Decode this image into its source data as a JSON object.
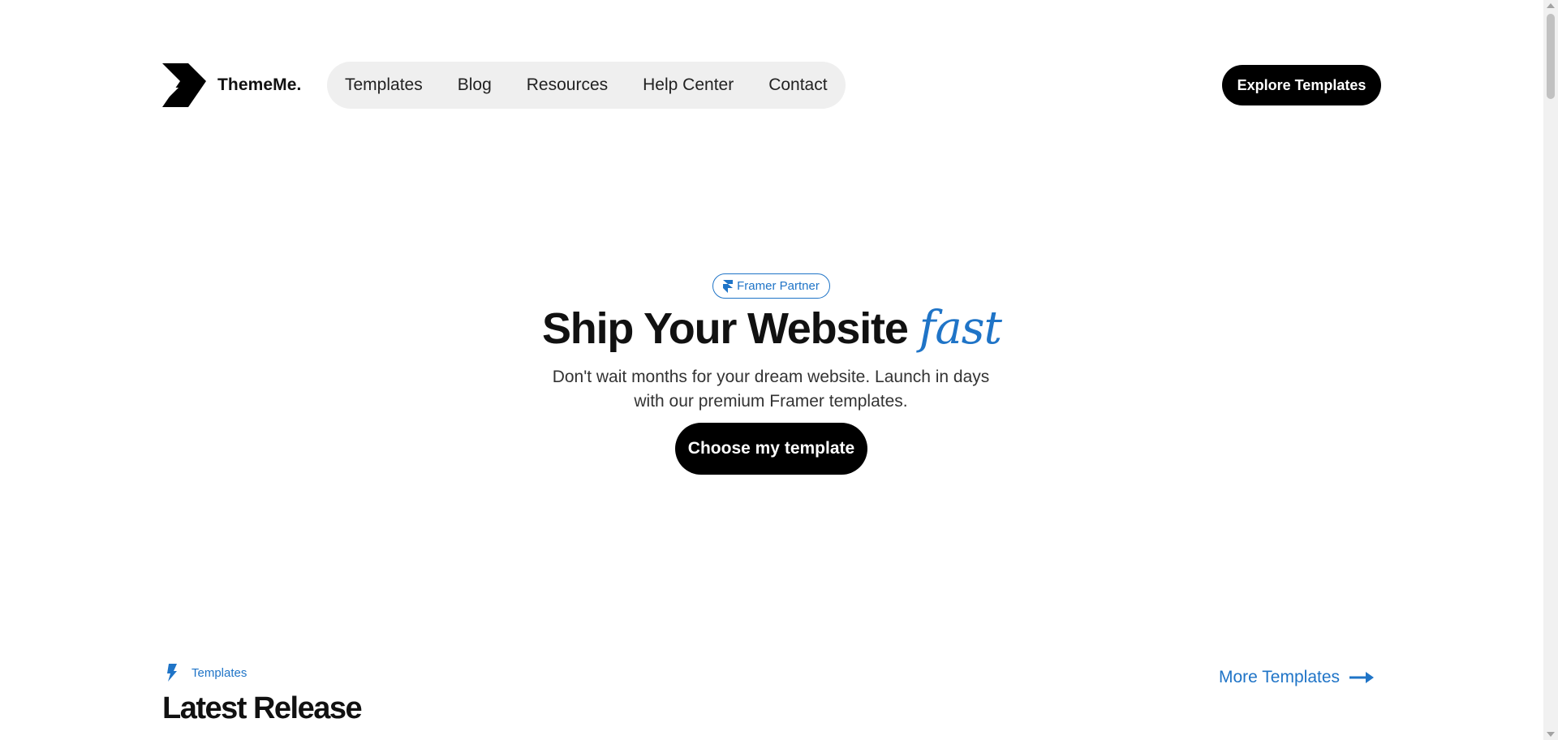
{
  "header": {
    "brand": "ThemeMe.",
    "logo_icon": "thememe-logo-icon",
    "nav": [
      {
        "label": "Templates"
      },
      {
        "label": "Blog"
      },
      {
        "label": "Resources"
      },
      {
        "label": "Help Center"
      },
      {
        "label": "Contact"
      }
    ],
    "cta_label": "Explore Templates"
  },
  "hero": {
    "badge_label": "Framer Partner",
    "badge_icon": "framer-icon",
    "title": "Ship Your Website",
    "title_accent": "fast",
    "subtitle": "Don't wait months for your dream website. Launch in days with our premium Framer templates.",
    "cta_label": "Choose my template"
  },
  "latest": {
    "tag_label": "Templates",
    "tag_icon": "lightning-icon",
    "title": "Latest Release",
    "more_label": "More Templates",
    "more_icon": "arrow-right-icon"
  },
  "colors": {
    "accent": "#1f74c7",
    "button_bg": "#000000",
    "nav_bg": "#efefef"
  }
}
